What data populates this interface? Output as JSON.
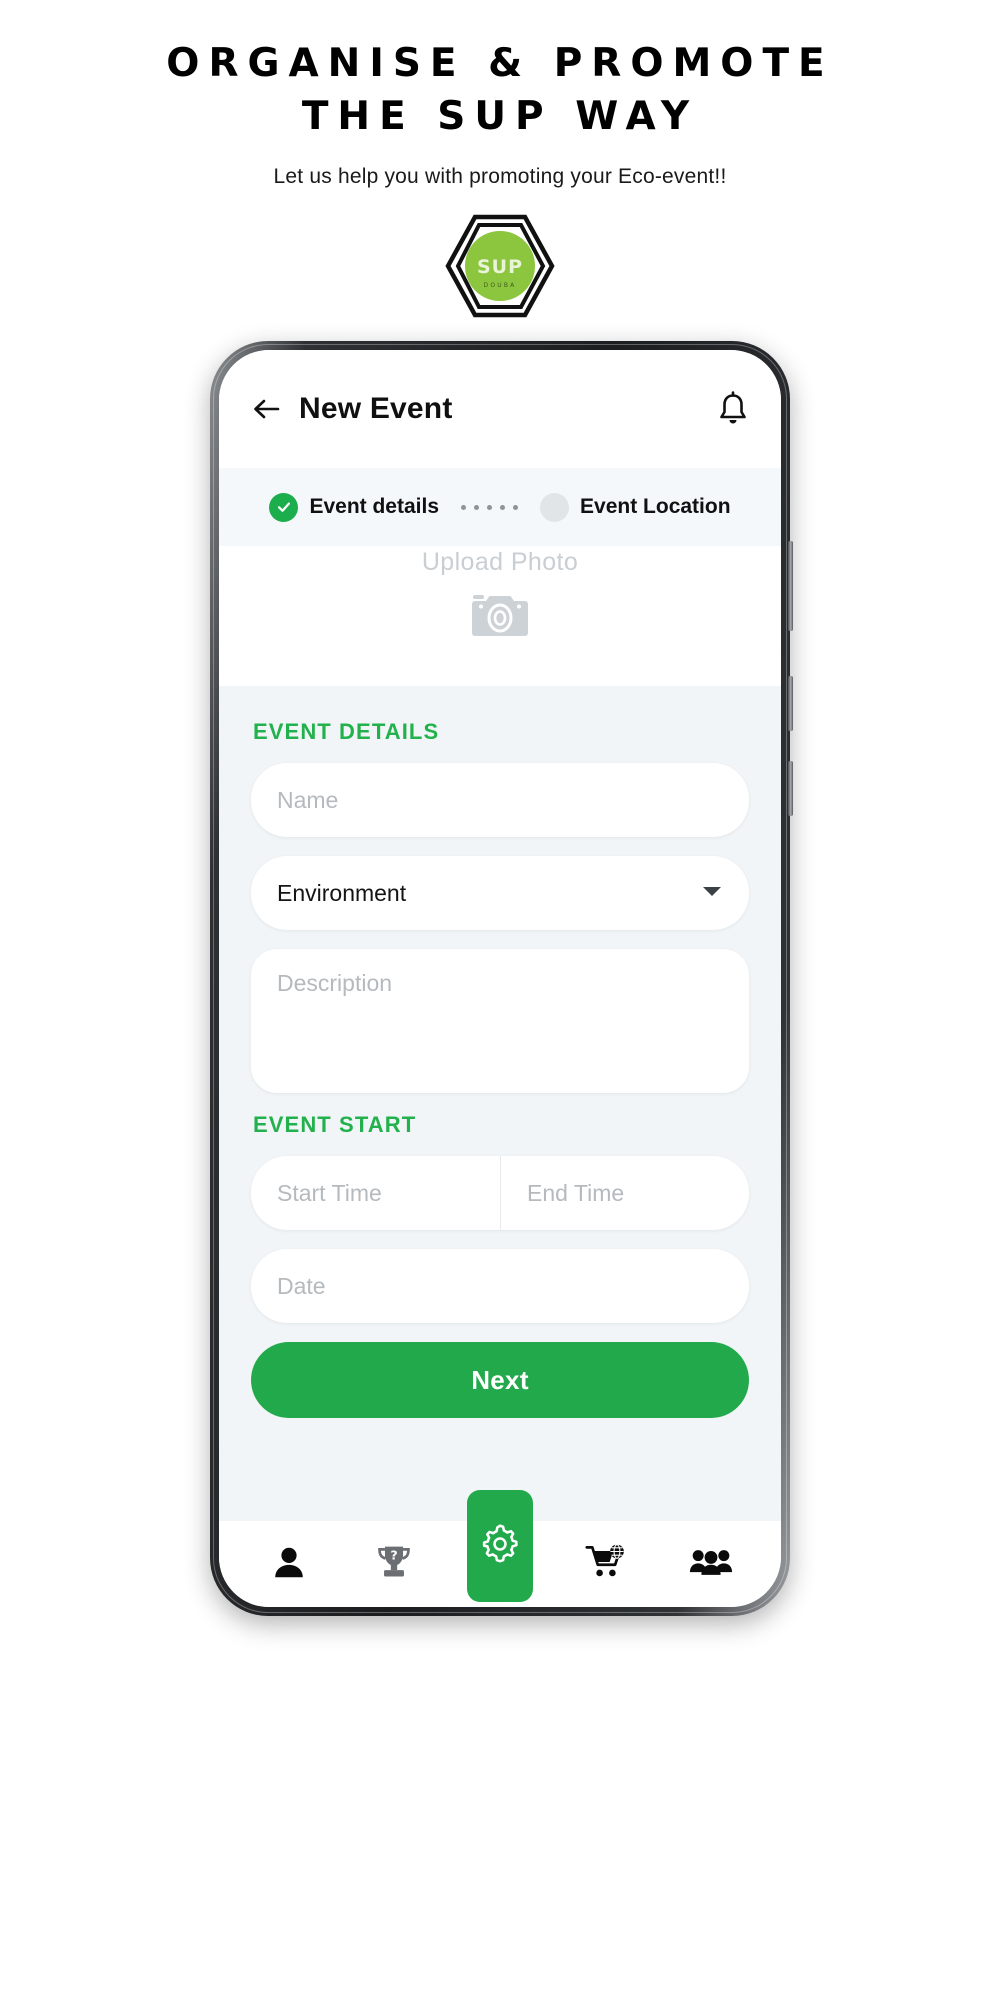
{
  "promo": {
    "title": "ORGANISE & PROMOTE THE SUP WAY",
    "subtitle": "Let us help you with promoting your Eco-event!!",
    "logo_text": "SUP",
    "logo_subtext": "D  O  U  B  A",
    "logo_color": "#8CC63E"
  },
  "app": {
    "header": {
      "back_icon": "arrow-left-icon",
      "title": "New Event",
      "bell_icon": "bell-icon"
    },
    "stepper": {
      "steps": [
        {
          "label": "Event details",
          "state": "completed"
        },
        {
          "label": "Event Location",
          "state": "pending"
        }
      ],
      "connector_dots": 5
    },
    "upload": {
      "label": "Upload Photo",
      "icon": "camera-icon"
    },
    "sections": [
      {
        "label": "EVENT DETAILS",
        "fields": [
          {
            "name": "name",
            "placeholder": "Name",
            "value": "",
            "type": "text"
          },
          {
            "name": "category",
            "placeholder": "",
            "value": "Environment",
            "type": "select"
          },
          {
            "name": "description",
            "placeholder": "Description",
            "value": "",
            "type": "textarea"
          }
        ]
      },
      {
        "label": "EVENT START",
        "fields": [
          {
            "name": "start_time",
            "placeholder": "Start Time",
            "value": "",
            "type": "text"
          },
          {
            "name": "end_time",
            "placeholder": "End Time",
            "value": "",
            "type": "text"
          },
          {
            "name": "date",
            "placeholder": "Date",
            "value": "",
            "type": "text"
          }
        ]
      }
    ],
    "primary_action": {
      "label": "Next"
    },
    "bottom_nav": {
      "items": [
        {
          "name": "profile",
          "icon": "person-icon",
          "active": false
        },
        {
          "name": "achievements",
          "icon": "trophy-question-icon",
          "active": false
        },
        {
          "name": "settings",
          "icon": "gear-icon",
          "active": true
        },
        {
          "name": "shop",
          "icon": "cart-globe-icon",
          "active": false
        },
        {
          "name": "community",
          "icon": "people-group-icon",
          "active": false
        }
      ]
    }
  },
  "colors": {
    "brand_green": "#22a94b",
    "section_green": "#22b14c",
    "logo_green": "#8CC63E",
    "screen_bg": "#f1f5f7",
    "stepper_bg": "#f4f8fb",
    "placeholder": "#b5babe"
  }
}
